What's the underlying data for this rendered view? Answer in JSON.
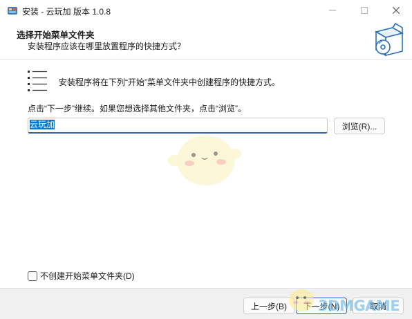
{
  "window": {
    "title": "安装 - 云玩加 版本 1.0.8",
    "icon": "installer-app-icon",
    "controls": {
      "minimize": "minimize-icon",
      "maximize": "maximize-icon",
      "close": "close-icon"
    }
  },
  "header": {
    "title": "选择开始菜单文件夹",
    "subtitle": "安装程序应该在哪里放置程序的快捷方式？",
    "logo_icon": "software-box-cd-icon"
  },
  "content": {
    "list_icon": "start-menu-list-icon",
    "description": "安装程序将在下列“开始”菜单文件夹中创建程序的快捷方式。",
    "hint": "点击“下一步”继续。如果您想选择其他文件夹，点击“浏览”。",
    "folder_value": "云玩加",
    "browse_label": "浏览(R)..."
  },
  "options": {
    "no_start_menu_label": "不创建开始菜单文件夹(D)",
    "no_start_menu_checked": false
  },
  "footer": {
    "back_label": "上一步(B)",
    "next_label": "下一步(N)",
    "cancel_label": "取消"
  },
  "watermark": {
    "text": "3DMGAME"
  },
  "colors": {
    "accent": "#2d62b5",
    "selection": "#0078d7",
    "footer_bg": "#f0f0f0"
  }
}
